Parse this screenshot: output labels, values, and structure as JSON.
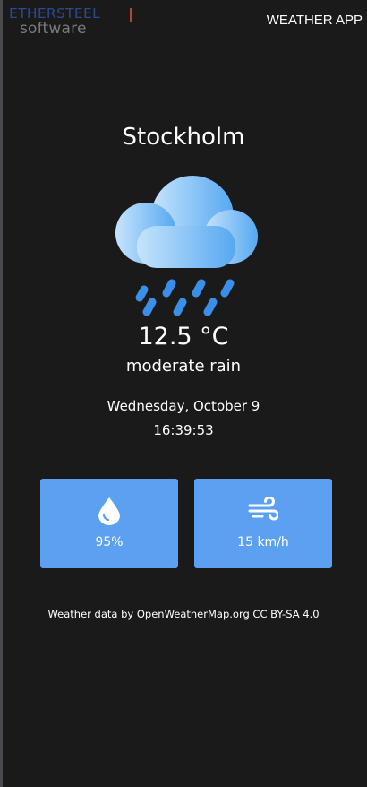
{
  "header": {
    "logo_top": "ETHERSTEEL",
    "logo_bottom": "software",
    "app_title": "WEATHER APP"
  },
  "weather": {
    "city": "Stockholm",
    "icon": "cloud-rain-icon",
    "temperature": "12.5 °C",
    "description": "moderate rain",
    "date": "Wednesday, October 9",
    "time": "16:39:53"
  },
  "cards": {
    "humidity": {
      "icon": "water-drop-icon",
      "value": "95%"
    },
    "wind": {
      "icon": "wind-icon",
      "value": "15 km/h"
    }
  },
  "footer": {
    "attribution": "Weather data by OpenWeatherMap.org CC BY-SA 4.0"
  },
  "colors": {
    "background": "#1b1a1b",
    "card": "#5ca0f2",
    "rain": "#3b8fe8",
    "cloud_light": "#bfe0fb",
    "cloud_dark": "#5aaaf2"
  }
}
